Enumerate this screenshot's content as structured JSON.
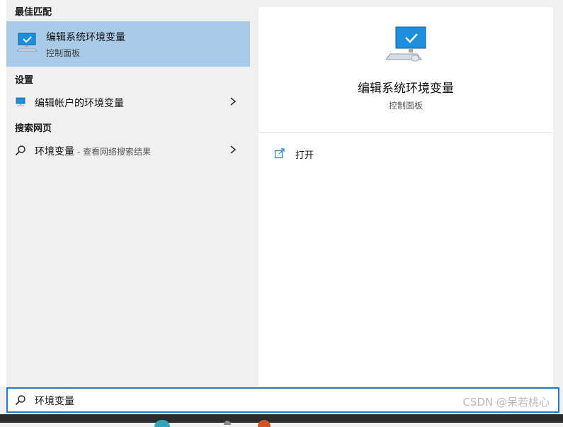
{
  "left_panel": {
    "best_match_header": "最佳匹配",
    "best_match": {
      "title": "编辑系统环境变量",
      "subtitle": "控制面板",
      "icon": "monitor-check-icon"
    },
    "settings_header": "设置",
    "settings_item": {
      "label": "编辑帐户的环境变量",
      "icon": "monitor-settings-icon"
    },
    "web_header": "搜索网页",
    "web_item": {
      "label": "环境变量",
      "sublabel": " - 查看网络搜索结果",
      "icon": "search-icon"
    }
  },
  "right_panel": {
    "title": "编辑系统环境变量",
    "subtitle": "控制面板",
    "icon": "monitor-check-icon",
    "actions": [
      {
        "label": "打开",
        "icon": "open-external-icon"
      }
    ]
  },
  "search": {
    "value": "环境变量",
    "icon": "search-icon"
  },
  "watermark": "CSDN @呆若桃心",
  "colors": {
    "selected_bg": "#a9cbea",
    "focus_border": "#1f7cc8",
    "panel_bg": "#f0f0f0",
    "icon_blue": "#1c8fdc"
  }
}
